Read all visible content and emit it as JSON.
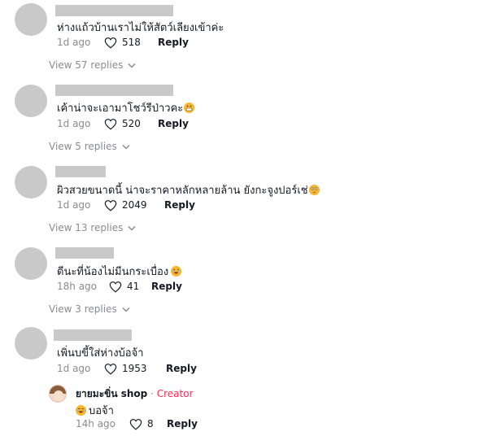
{
  "comments": [
    {
      "text": "ห่างแถ้วบ้านเราไม่ให้สัตว์เลียงเข้าค่ะ",
      "time": "1d ago",
      "likes": "518",
      "reply_label": "Reply",
      "view_replies": "View 57 replies"
    },
    {
      "text": "เค้าน่าจะเอามาโชว์รีป่าวคะ",
      "time": "1d ago",
      "likes": "520",
      "reply_label": "Reply",
      "view_replies": "View 5 replies",
      "emoji": "grimacing-emoji"
    },
    {
      "text": "ผิวสวยขนาดนี้ น่าจะราคาหลักหลายล้าน ยังกะจูงปอร์เช่",
      "time": "1d ago",
      "likes": "2049",
      "reply_label": "Reply",
      "view_replies": "View 13 replies",
      "emoji": "flushed-emoji"
    },
    {
      "text": "ดีนะที่น้องไม่มีนกระเบื่อง",
      "time": "18h ago",
      "likes": "41",
      "reply_label": "Reply",
      "view_replies": "View 3 replies",
      "emoji": "rofl-emoji"
    },
    {
      "text": "เพิ่นบขี้ใส่ห่างบ้อจ้า",
      "time": "1d ago",
      "likes": "1953",
      "reply_label": "Reply"
    }
  ],
  "creator_reply": {
    "username": "ยายมะขิ่น shop",
    "separator": " · ",
    "badge": "Creator",
    "text": "บอจ้า",
    "emoji": "joy-emoji",
    "time": "14h ago",
    "likes": "8",
    "reply_label": "Reply"
  },
  "colors": {
    "placeholder_gray": "#c9c9c9",
    "meta_gray": "#8a8b91",
    "creator_red": "#fe2c55"
  },
  "icons": {
    "like": "heart-outline-icon",
    "expand": "chevron-down-icon"
  }
}
